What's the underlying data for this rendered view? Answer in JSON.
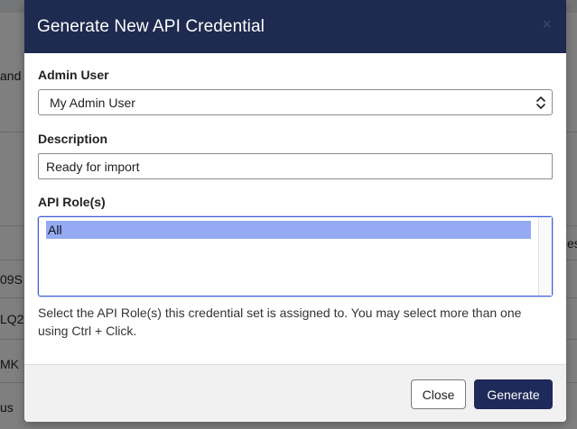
{
  "background": {
    "fragments": [
      "and",
      "es",
      "09S",
      "LQ2",
      "MK",
      "us"
    ]
  },
  "modal": {
    "title": "Generate New API Credential",
    "close_glyph": "×",
    "admin_user": {
      "label": "Admin User",
      "selected": "My Admin User"
    },
    "description": {
      "label": "Description",
      "value": "Ready for import"
    },
    "api_roles": {
      "label": "API Role(s)",
      "options": [
        {
          "label": "All",
          "selected": true
        }
      ],
      "help": "Select the API Role(s) this credential set is assigned to. You may select more than one using Ctrl + Click."
    },
    "footer": {
      "close_label": "Close",
      "generate_label": "Generate"
    }
  },
  "colors": {
    "header": "#1e2a4f",
    "primary_button": "#1e2a5a",
    "selected_option": "#94aaf3",
    "focus_border": "#3d5bd9"
  },
  "icons": {
    "close": "close-icon",
    "select_arrow": "chevron-updown-icon"
  }
}
